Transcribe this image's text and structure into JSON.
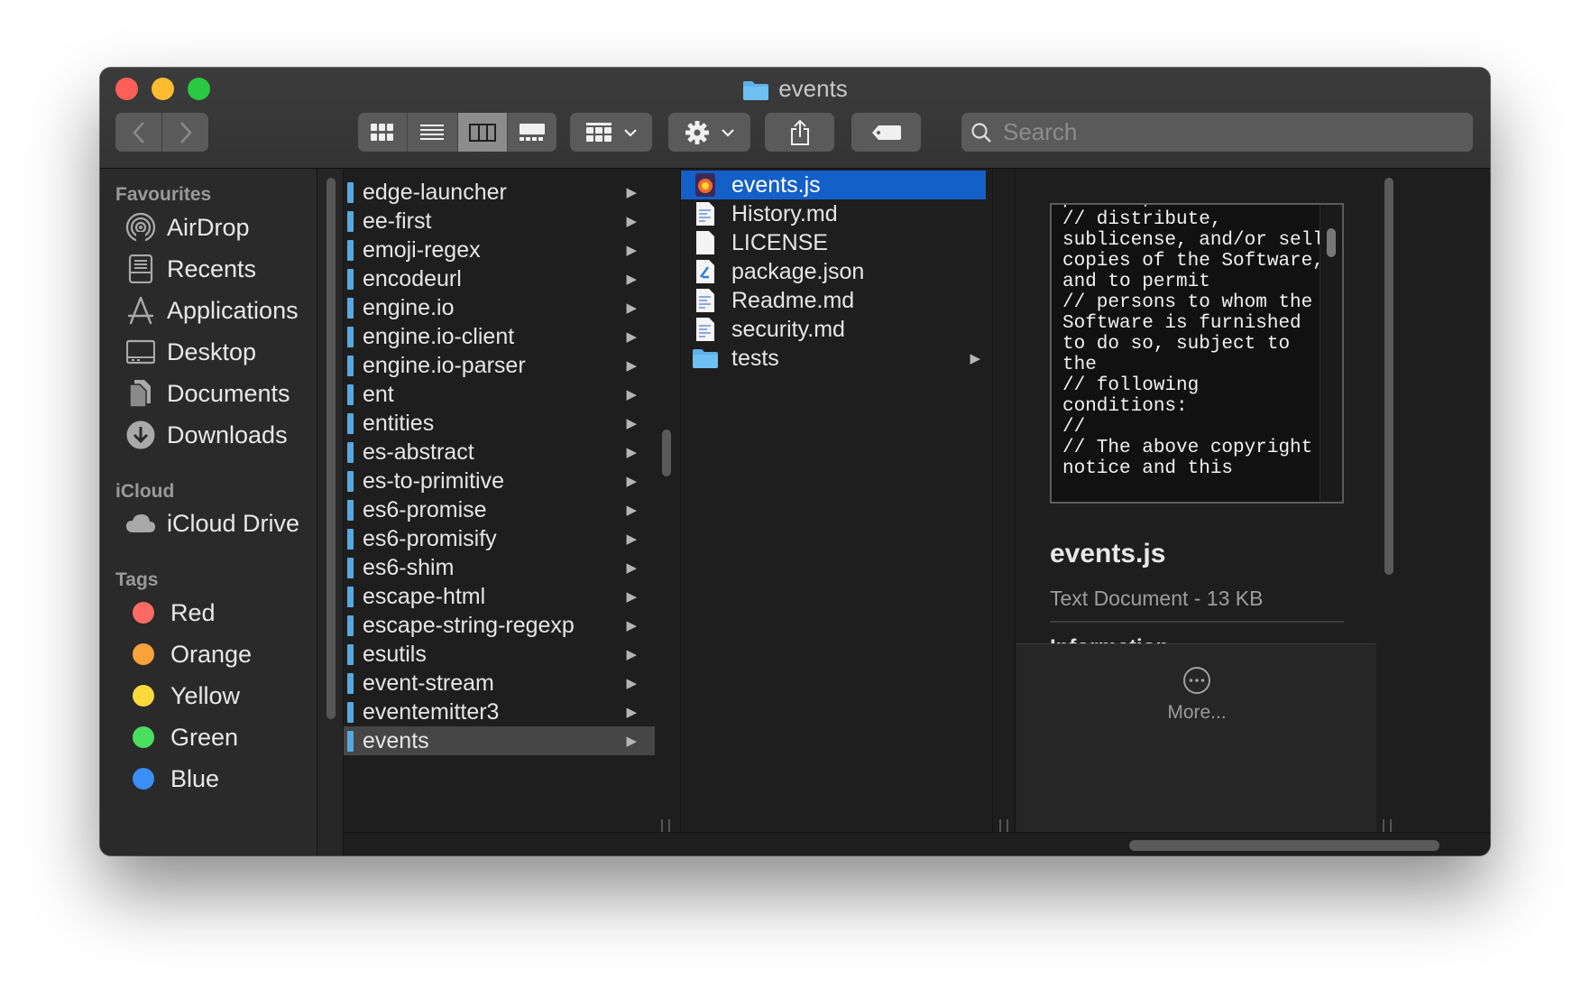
{
  "window": {
    "title": "events"
  },
  "toolbar": {
    "search_placeholder": "Search"
  },
  "sidebar": {
    "favourites_header": "Favourites",
    "favourites": [
      {
        "label": "AirDrop",
        "icon": "airdrop-icon"
      },
      {
        "label": "Recents",
        "icon": "recents-icon"
      },
      {
        "label": "Applications",
        "icon": "applications-icon"
      },
      {
        "label": "Desktop",
        "icon": "desktop-icon"
      },
      {
        "label": "Documents",
        "icon": "documents-icon"
      },
      {
        "label": "Downloads",
        "icon": "downloads-icon"
      }
    ],
    "icloud_header": "iCloud",
    "icloud": [
      {
        "label": "iCloud Drive",
        "icon": "icloud-icon"
      }
    ],
    "tags_header": "Tags",
    "tags": [
      {
        "label": "Red",
        "color": "#fe6a63"
      },
      {
        "label": "Orange",
        "color": "#f7a33a"
      },
      {
        "label": "Yellow",
        "color": "#f9d93c"
      },
      {
        "label": "Green",
        "color": "#4ade5e"
      },
      {
        "label": "Blue",
        "color": "#3a8ef6"
      }
    ]
  },
  "column1": {
    "items": [
      "edge-launcher",
      "ee-first",
      "emoji-regex",
      "encodeurl",
      "engine.io",
      "engine.io-client",
      "engine.io-parser",
      "ent",
      "entities",
      "es-abstract",
      "es-to-primitive",
      "es6-promise",
      "es6-promisify",
      "es6-shim",
      "escape-html",
      "escape-string-regexp",
      "esutils",
      "event-stream",
      "eventemitter3",
      "events"
    ],
    "selected": "events"
  },
  "column2": {
    "items": [
      {
        "label": "events.js",
        "icon": "js-file-icon",
        "selected": true
      },
      {
        "label": "History.md",
        "icon": "text-file-icon"
      },
      {
        "label": "LICENSE",
        "icon": "blank-file-icon"
      },
      {
        "label": "package.json",
        "icon": "json-file-icon"
      },
      {
        "label": "Readme.md",
        "icon": "text-file-icon"
      },
      {
        "label": "security.md",
        "icon": "text-file-icon"
      },
      {
        "label": "tests",
        "icon": "folder-icon",
        "is_folder": true
      }
    ]
  },
  "preview": {
    "text": "publish,\n// distribute,\nsublicense, and/or sell\ncopies of the Software,\nand to permit\n// persons to whom the\nSoftware is furnished\nto do so, subject to\nthe\n// following\nconditions:\n//\n// The above copyright\nnotice and this",
    "filename": "events.js",
    "kind": "Text Document - 13 KB",
    "info_header": "Information",
    "more_label": "More..."
  }
}
